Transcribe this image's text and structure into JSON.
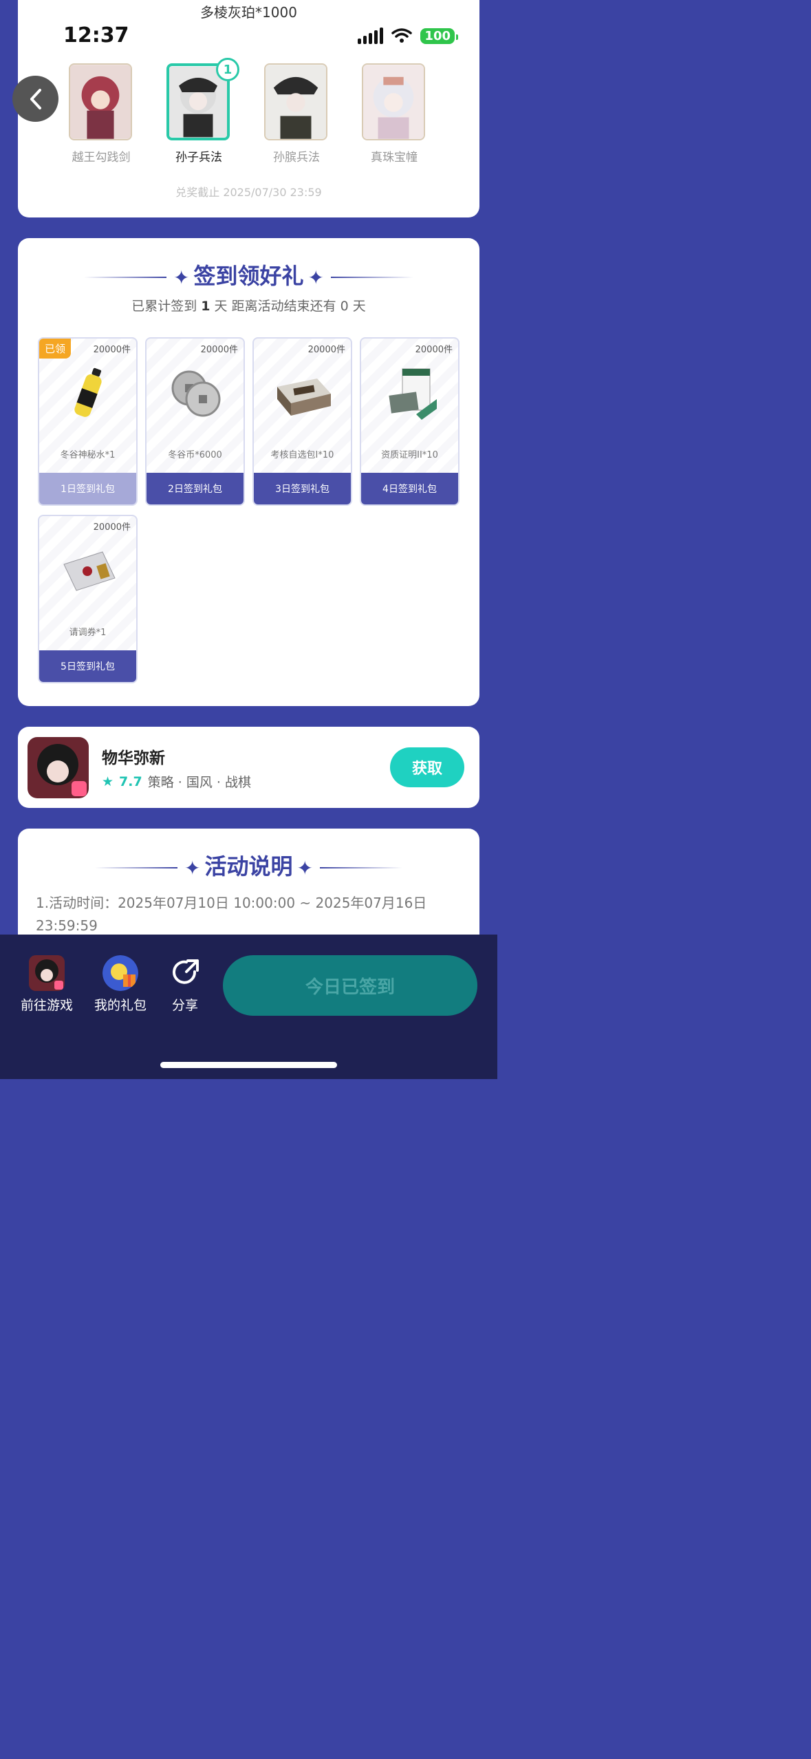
{
  "status_bar": {
    "time": "12:37",
    "battery": "100"
  },
  "top": {
    "reward_title": "多棱灰珀*1000",
    "characters": [
      {
        "name": "越王勾践剑",
        "selected": false
      },
      {
        "name": "孙子兵法",
        "selected": true,
        "badge": "1"
      },
      {
        "name": "孙膑兵法",
        "selected": false
      },
      {
        "name": "真珠宝幢",
        "selected": false
      }
    ],
    "deadline": "兑奖截止 2025/07/30 23:59"
  },
  "sign": {
    "title": "签到领好礼",
    "summary_prefix": "已累计签到",
    "summary_days": "1",
    "summary_mid": "天  距离活动结束还有",
    "summary_remaining": "0",
    "summary_suffix": "天",
    "gifts": [
      {
        "stock": "20000件",
        "item": "冬谷神秘水*1",
        "label": "1日签到礼包",
        "claimed": "已领",
        "icon": "bottle-icon"
      },
      {
        "stock": "20000件",
        "item": "冬谷币*6000",
        "label": "2日签到礼包",
        "icon": "coins-icon"
      },
      {
        "stock": "20000件",
        "item": "考核自选包I*10",
        "label": "3日签到礼包",
        "icon": "box-icon"
      },
      {
        "stock": "20000件",
        "item": "资质证明II*10",
        "label": "4日签到礼包",
        "icon": "certificate-icon"
      },
      {
        "stock": "20000件",
        "item": "请调券*1",
        "label": "5日签到礼包",
        "icon": "envelope-icon"
      }
    ]
  },
  "game": {
    "name": "物华弥新",
    "rating": "7.7",
    "tags": "策略 · 国风 · 战棋",
    "get_label": "获取"
  },
  "rules": {
    "title": "活动说明",
    "line1": "1.活动时间：2025年07月10日 10:00:00 ~ 2025年07月16日 23:59:59"
  },
  "bottom": {
    "go_game": "前往游戏",
    "my_gifts": "我的礼包",
    "share": "分享",
    "signed": "今日已签到"
  },
  "colors": {
    "primary": "#3b43a3",
    "accent": "#1fd1c1",
    "claimed": "#f5a623"
  }
}
